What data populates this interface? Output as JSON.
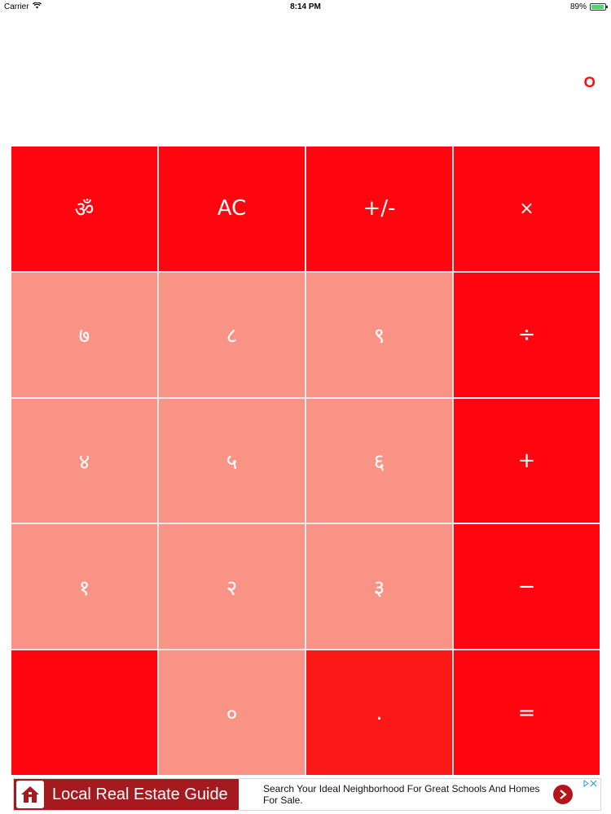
{
  "status_bar": {
    "carrier": "Carrier",
    "time": "8:14 PM",
    "battery": "89%",
    "battery_level": 0.89
  },
  "display": {
    "value": "०"
  },
  "keypad": {
    "row1": [
      "ॐ",
      "AC",
      "+/-",
      "×"
    ],
    "row2": [
      "७",
      "८",
      "९",
      "÷"
    ],
    "row3": [
      "४",
      "५",
      "६",
      "+"
    ],
    "row4": [
      "१",
      "२",
      "३",
      "−"
    ],
    "row5": [
      "",
      "०",
      ".",
      "="
    ]
  },
  "ad": {
    "title": "Local Real Estate Guide",
    "tagline": "Search Your Ideal Neighborhood For Great Schools And Homes For Sale.",
    "icon": "house-icon"
  },
  "colors": {
    "operator_key": "#ff050f",
    "number_key": "#f99386",
    "dot_key": "#fb1918",
    "display_text": "#ff0a12",
    "ad_brand": "#a41a1f"
  }
}
